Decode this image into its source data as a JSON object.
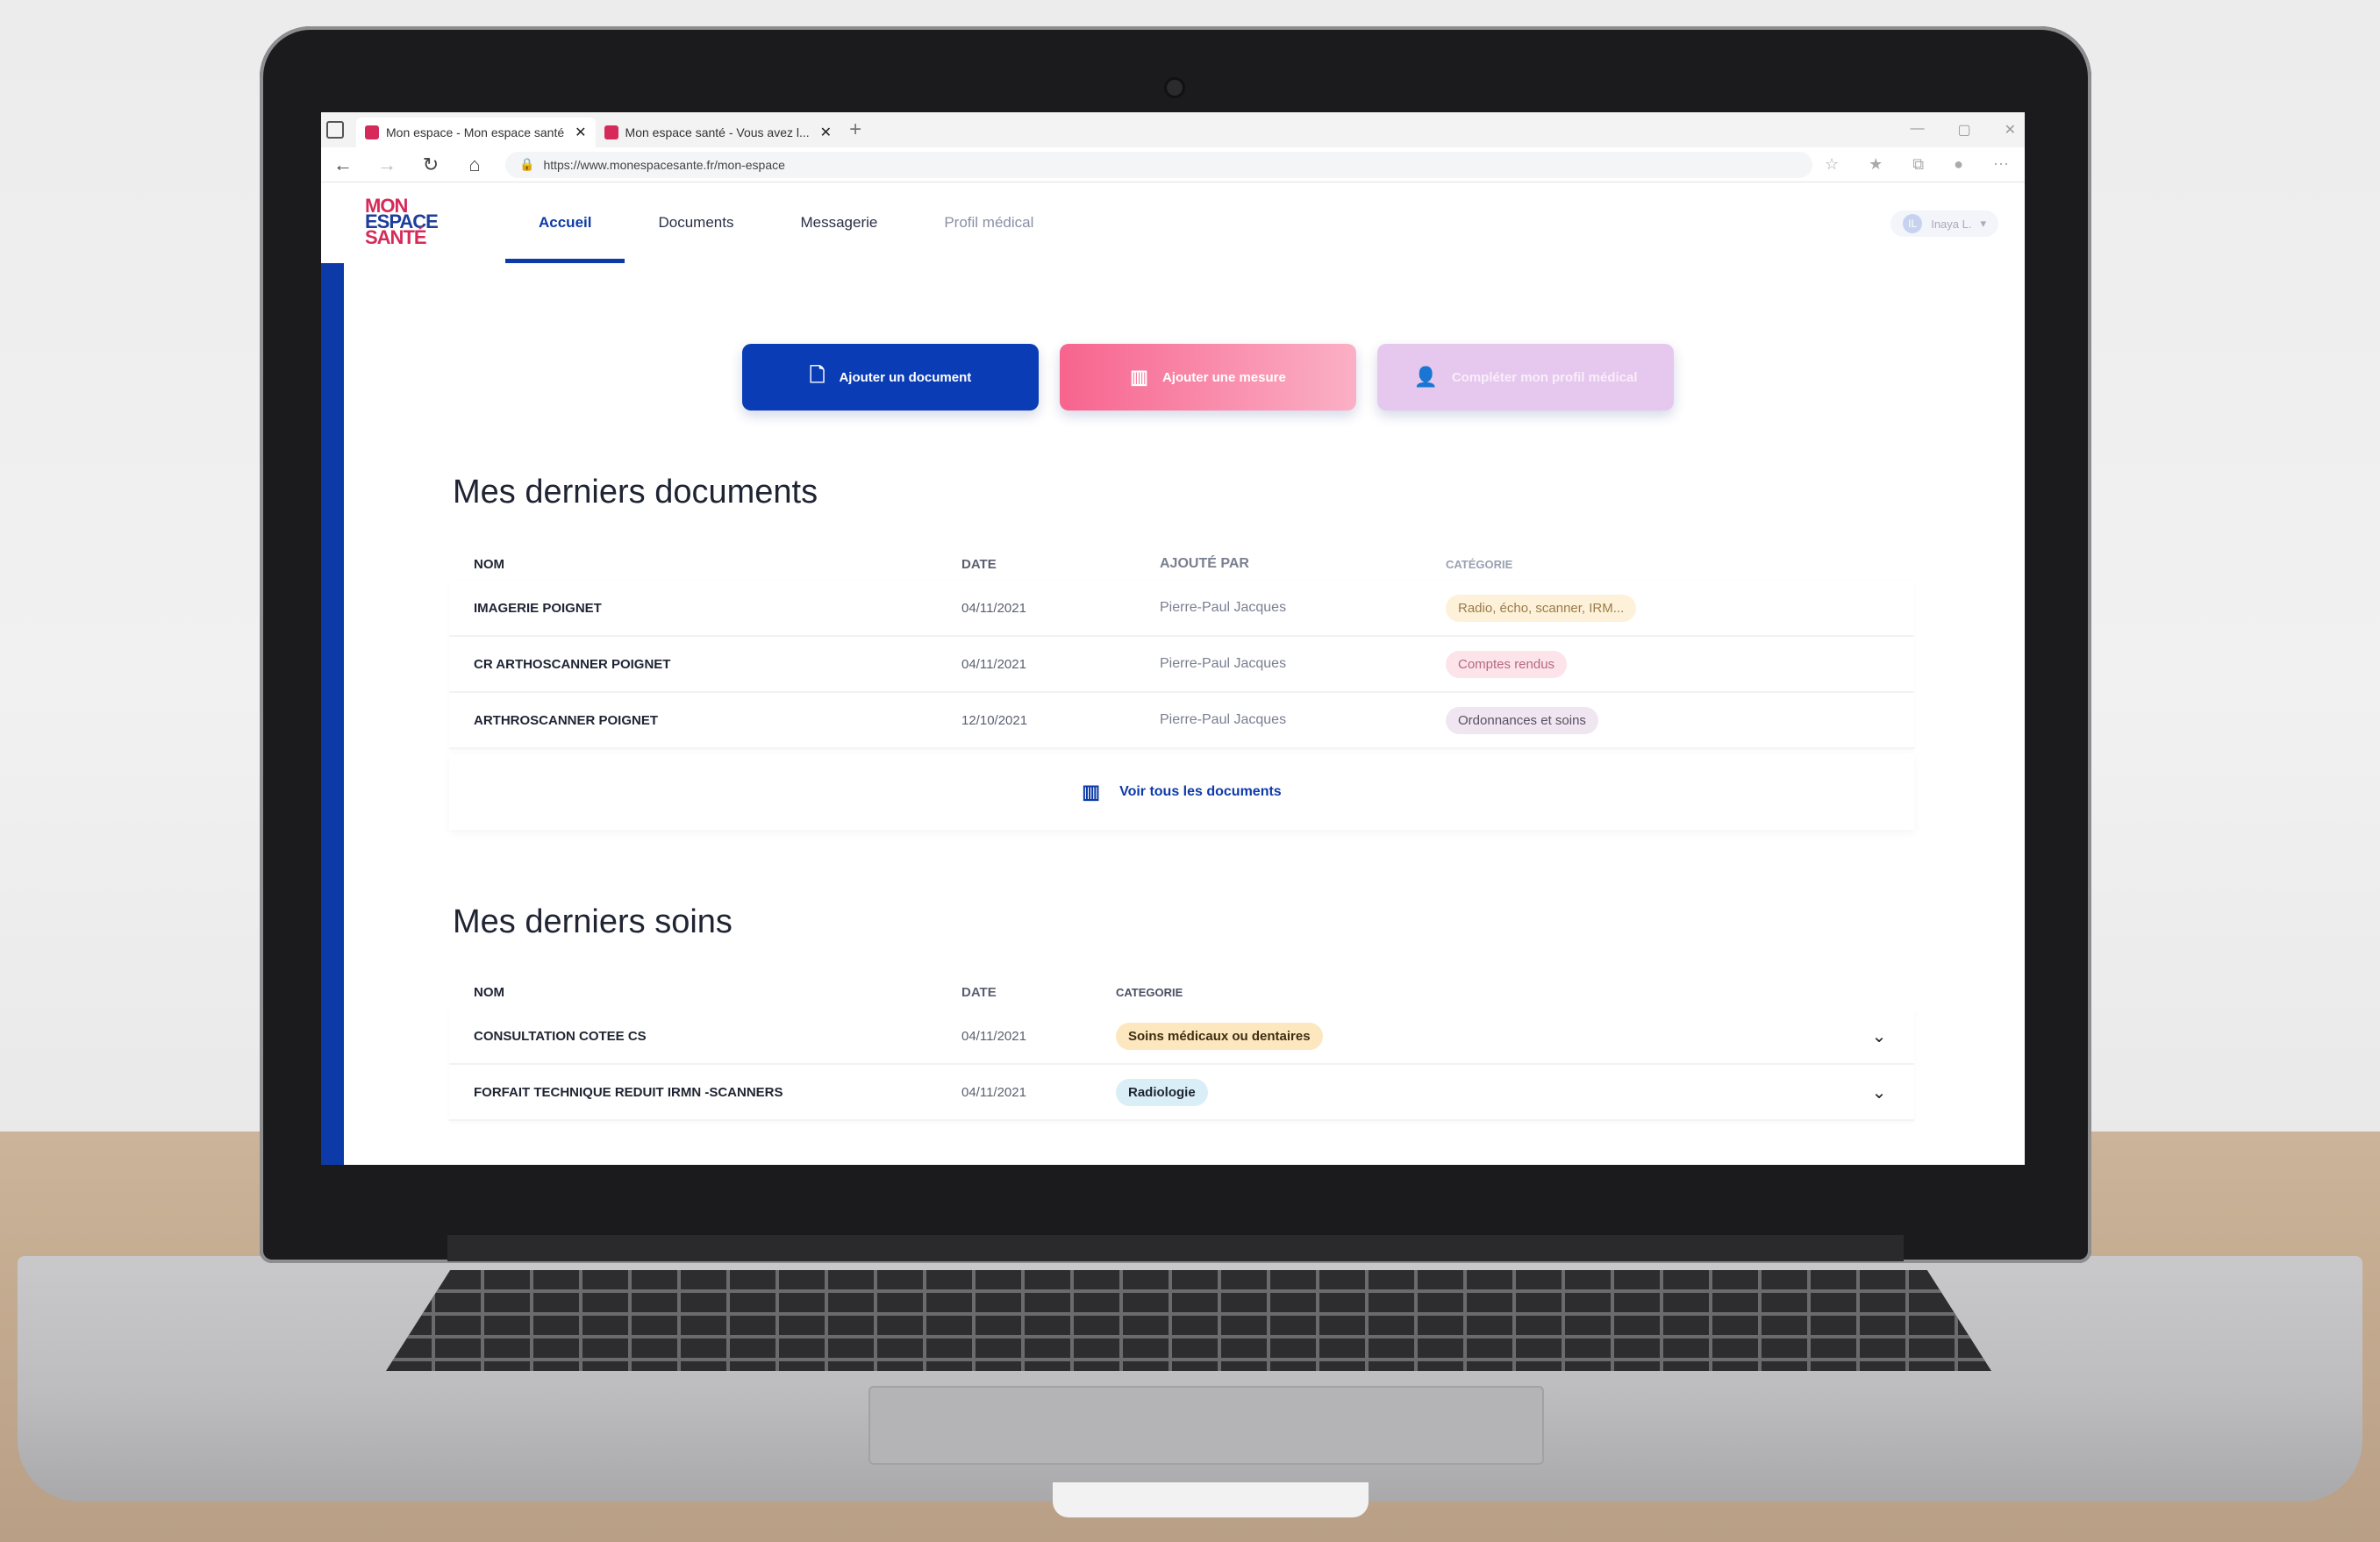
{
  "browser": {
    "tabs": [
      {
        "title": "Mon espace - Mon espace santé",
        "active": true
      },
      {
        "title": "Mon espace santé - Vous avez l...",
        "active": false
      }
    ],
    "new_tab": "+",
    "url": "https://www.monespacesante.fr/mon-espace"
  },
  "app": {
    "logo": {
      "line1": "MON",
      "line2": "ESPACE",
      "line3": "SANTÉ"
    },
    "nav": [
      {
        "label": "Accueil",
        "active": true
      },
      {
        "label": "Documents",
        "active": false
      },
      {
        "label": "Messagerie",
        "active": false
      },
      {
        "label": "Profil médical",
        "active": false
      }
    ],
    "user": {
      "initial": "IL",
      "name": "Inaya L."
    }
  },
  "actions": {
    "add_document": "Ajouter un document",
    "add_measure": "Ajouter une mesure",
    "complete_profile": "Compléter mon profil médical"
  },
  "documents": {
    "title": "Mes derniers documents",
    "columns": {
      "nom": "NOM",
      "date": "DATE",
      "added_by": "AJOUTÉ PAR",
      "category": "CATÉGORIE"
    },
    "rows": [
      {
        "nom": "IMAGERIE POIGNET",
        "date": "04/11/2021",
        "added_by": "Pierre-Paul Jacques",
        "category": "Radio, écho, scanner, IRM..."
      },
      {
        "nom": "CR ARTHOSCANNER POIGNET",
        "date": "04/11/2021",
        "added_by": "Pierre-Paul Jacques",
        "category": "Comptes rendus"
      },
      {
        "nom": "ARTHROSCANNER POIGNET",
        "date": "12/10/2021",
        "added_by": "Pierre-Paul Jacques",
        "category": "Ordonnances et soins"
      }
    ],
    "see_all": "Voir tous les documents"
  },
  "soins": {
    "title": "Mes derniers soins",
    "columns": {
      "nom": "NOM",
      "date": "DATE",
      "category": "CATEGORIE"
    },
    "rows": [
      {
        "nom": "CONSULTATION COTEE CS",
        "date": "04/11/2021",
        "category": "Soins médicaux ou dentaires"
      },
      {
        "nom": "FORFAIT TECHNIQUE REDUIT IRMN -SCANNERS",
        "date": "04/11/2021",
        "category": "Radiologie"
      }
    ]
  },
  "colors": {
    "primary": "#0a3cb5",
    "pink": "#f7648e",
    "lilac": "#e6c8ee",
    "brand_red": "#d62a5a"
  }
}
